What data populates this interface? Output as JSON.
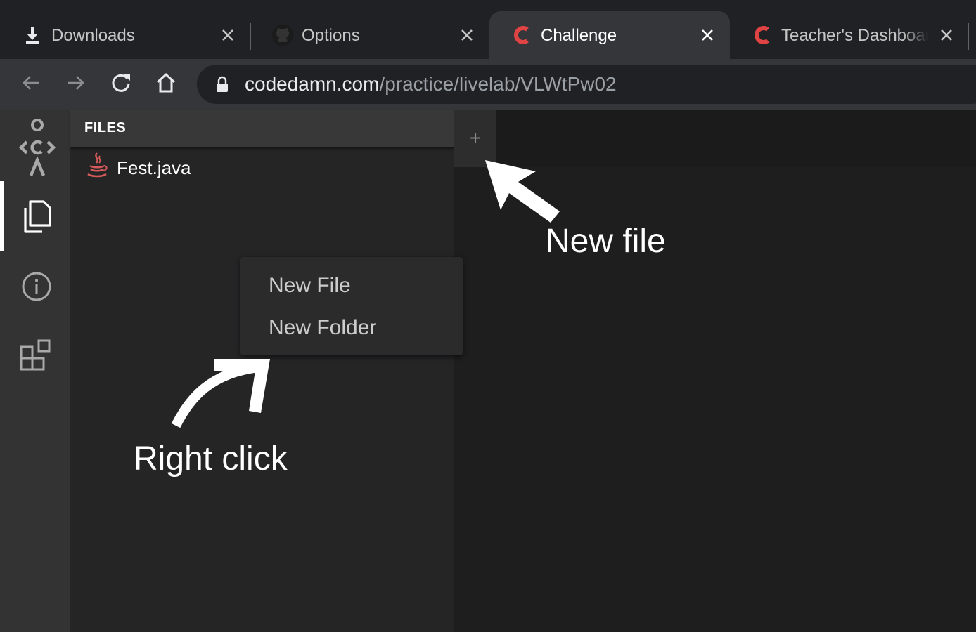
{
  "browser": {
    "tabs": [
      {
        "title": "Downloads",
        "icon": "download-icon",
        "active": false
      },
      {
        "title": "Options",
        "icon": "github-icon",
        "active": false
      },
      {
        "title": "Challenge",
        "icon": "codedamn-icon",
        "active": true
      },
      {
        "title": "Teacher's Dashboard",
        "icon": "codedamn-icon",
        "active": false
      }
    ],
    "url_host": "codedamn.com",
    "url_path": "/practice/livelab/VLWtPw02"
  },
  "activity_bar": {
    "items": [
      {
        "icon": "codedamn-logo-icon"
      },
      {
        "icon": "files-icon",
        "active": true
      },
      {
        "icon": "info-icon"
      },
      {
        "icon": "extensions-icon"
      }
    ]
  },
  "sidebar": {
    "header": "FILES",
    "files": [
      {
        "name": "Fest.java",
        "icon": "java-icon"
      }
    ]
  },
  "editor": {
    "new_file_symbol": "+"
  },
  "context_menu": {
    "items": [
      "New File",
      "New Folder"
    ]
  },
  "annotations": {
    "new_file": "New file",
    "right_click": "Right click"
  },
  "colors": {
    "accent_red": "#e04343",
    "java_red": "#d65a5a"
  }
}
